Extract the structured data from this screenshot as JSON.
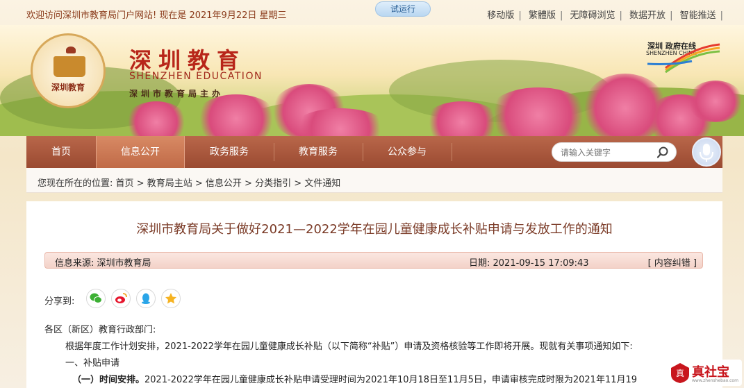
{
  "topbar": {
    "welcome": "欢迎访问深圳市教育局门户网站! 现在是 2021年9月22日 星期三",
    "trial_badge": "试运行",
    "links": [
      "移动版",
      "繁體版",
      "无障碍浏览",
      "数据开放",
      "智能推送"
    ]
  },
  "header": {
    "emblem_text": "深圳教育",
    "logo_cn": "深圳教育",
    "logo_en": "SHENZHEN EDUCATION",
    "logo_sub": "深圳市教育局主办",
    "szchina_cn": "深圳 政府在线",
    "szchina_en": "SHENZHEN CHINA"
  },
  "nav": {
    "items": [
      "首页",
      "信息公开",
      "政务服务",
      "教育服务",
      "公众参与"
    ],
    "active_index": 1,
    "search_placeholder": "请输入关键字"
  },
  "breadcrumb": {
    "prefix": "您现在所在的位置: ",
    "items": [
      "首页",
      "教育局主站",
      "信息公开",
      "分类指引",
      "文件通知"
    ]
  },
  "article": {
    "title": "深圳市教育局关于做好2021—2022学年在园儿童健康成长补贴申请与发放工作的通知",
    "source": "信息来源:   深圳市教育局",
    "date": "日期:  2021-09-15 17:09:43",
    "report_error": "[ 内容纠错 ]",
    "share_label": "分享到:",
    "share_buttons": [
      "wechat-icon",
      "weibo-icon",
      "qq-icon",
      "qzone-icon"
    ],
    "greeting": "各区（新区）教育行政部门:",
    "para1": "根据年度工作计划安排，2021-2022学年在园儿童健康成长补贴（以下简称“补贴”）申请及资格核验等工作即将开展。现就有关事项通知如下:",
    "section1": "一、补贴申请",
    "item1_label": "（一）时间安排。",
    "item1_text": "2021-2022学年在园儿童健康成长补贴申请受理时间为2021年10月18日至11月5日，申请审核完成时限为2021年11月19"
  },
  "watermark": {
    "text": "真社宝",
    "sub": "www.zhenshebao.com"
  },
  "colors": {
    "nav": "#a8553a",
    "title": "#7a3a26",
    "accent_red": "#b8261a"
  }
}
